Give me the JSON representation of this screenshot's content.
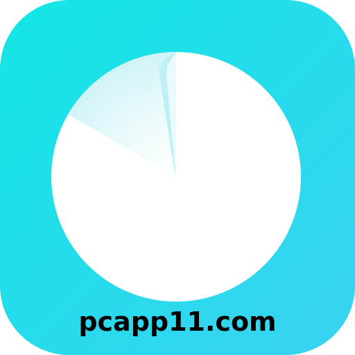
{
  "icon": {
    "name": "pie-timer-icon",
    "background_gradient": [
      "#12E6E4",
      "#3AD2F2"
    ],
    "dial_color": "#FFFFFF",
    "fold_shade": "#D6F6F9",
    "remaining_fraction": 0.97
  },
  "watermark": {
    "text": "pcapp11.com"
  }
}
